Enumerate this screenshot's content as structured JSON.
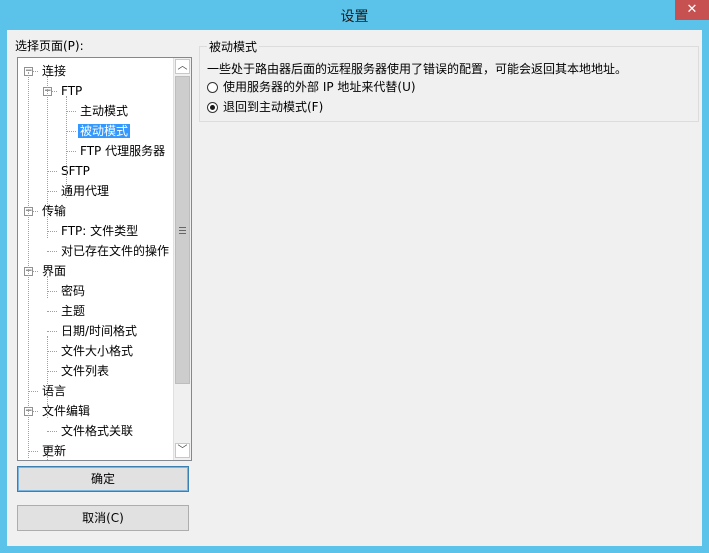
{
  "window": {
    "title": "设置",
    "close_glyph": "✕"
  },
  "sidebar": {
    "label": "选择页面(P):",
    "tree": [
      {
        "label": "连接",
        "level": 0,
        "expanded": true
      },
      {
        "label": "FTP",
        "level": 1,
        "expanded": true
      },
      {
        "label": "主动模式",
        "level": 2
      },
      {
        "label": "被动模式",
        "level": 2,
        "selected": true
      },
      {
        "label": "FTP 代理服务器",
        "level": 2
      },
      {
        "label": "SFTP",
        "level": 1
      },
      {
        "label": "通用代理",
        "level": 1
      },
      {
        "label": "传输",
        "level": 0,
        "expanded": true
      },
      {
        "label": "FTP: 文件类型",
        "level": 1
      },
      {
        "label": "对已存在文件的操作",
        "level": 1
      },
      {
        "label": "界面",
        "level": 0,
        "expanded": true
      },
      {
        "label": "密码",
        "level": 1
      },
      {
        "label": "主题",
        "level": 1
      },
      {
        "label": "日期/时间格式",
        "level": 1
      },
      {
        "label": "文件大小格式",
        "level": 1
      },
      {
        "label": "文件列表",
        "level": 1
      },
      {
        "label": "语言",
        "level": 0
      },
      {
        "label": "文件编辑",
        "level": 0,
        "expanded": true
      },
      {
        "label": "文件格式关联",
        "level": 1
      },
      {
        "label": "更新",
        "level": 0
      }
    ]
  },
  "buttons": {
    "ok": "确定",
    "cancel": "取消(C)"
  },
  "passive": {
    "group_title": "被动模式",
    "description": "一些处于路由器后面的远程服务器使用了错误的配置，可能会返回其本地地址。",
    "options": [
      {
        "label": "使用服务器的外部 IP 地址来代替(U)",
        "checked": false
      },
      {
        "label": "退回到主动模式(F)",
        "checked": true
      }
    ]
  }
}
